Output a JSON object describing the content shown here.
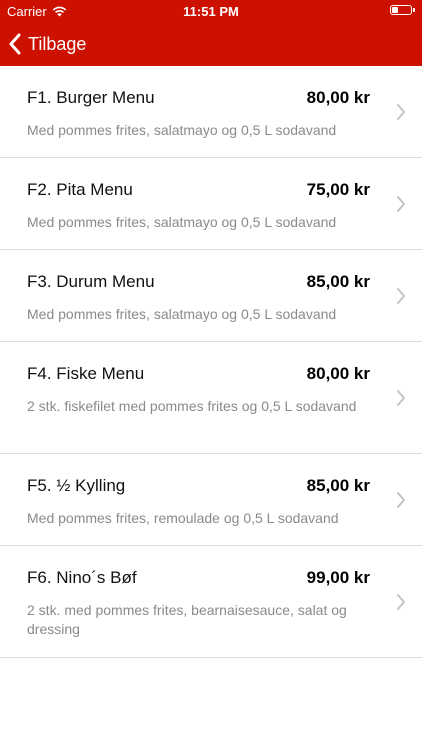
{
  "status_bar": {
    "carrier": "Carrier",
    "time": "11:51 PM",
    "battery_level": 0.35,
    "icons": [
      "wifi-icon",
      "battery-icon"
    ]
  },
  "nav": {
    "back_label": "Tilbage",
    "back_icon": "chevron-left-icon"
  },
  "colors": {
    "header_bg": "#cc1100",
    "header_text": "#ffffff",
    "description_text": "#8a8a8a",
    "separator": "#dcdcdc"
  },
  "menu_items": [
    {
      "name": "F1. Burger Menu",
      "price": "80,00 kr",
      "description": "Med pommes frites, salatmayo og 0,5 L sodavand"
    },
    {
      "name": "F2. Pita Menu",
      "price": "75,00 kr",
      "description": "Med pommes frites, salatmayo og 0,5 L sodavand"
    },
    {
      "name": "F3. Durum Menu",
      "price": "85,00 kr",
      "description": "Med pommes frites, salatmayo og 0,5 L sodavand"
    },
    {
      "name": "F4. Fiske Menu",
      "price": "80,00 kr",
      "description": "2 stk. fiskefilet med pommes frites og 0,5 L sodavand"
    },
    {
      "name": "F5. ½ Kylling",
      "price": "85,00 kr",
      "description": "Med pommes frites, remoulade og 0,5 L sodavand"
    },
    {
      "name": "F6. Nino´s Bøf",
      "price": "99,00 kr",
      "description": "2 stk. med pommes frites, bearnaisesauce, salat og dressing"
    }
  ]
}
